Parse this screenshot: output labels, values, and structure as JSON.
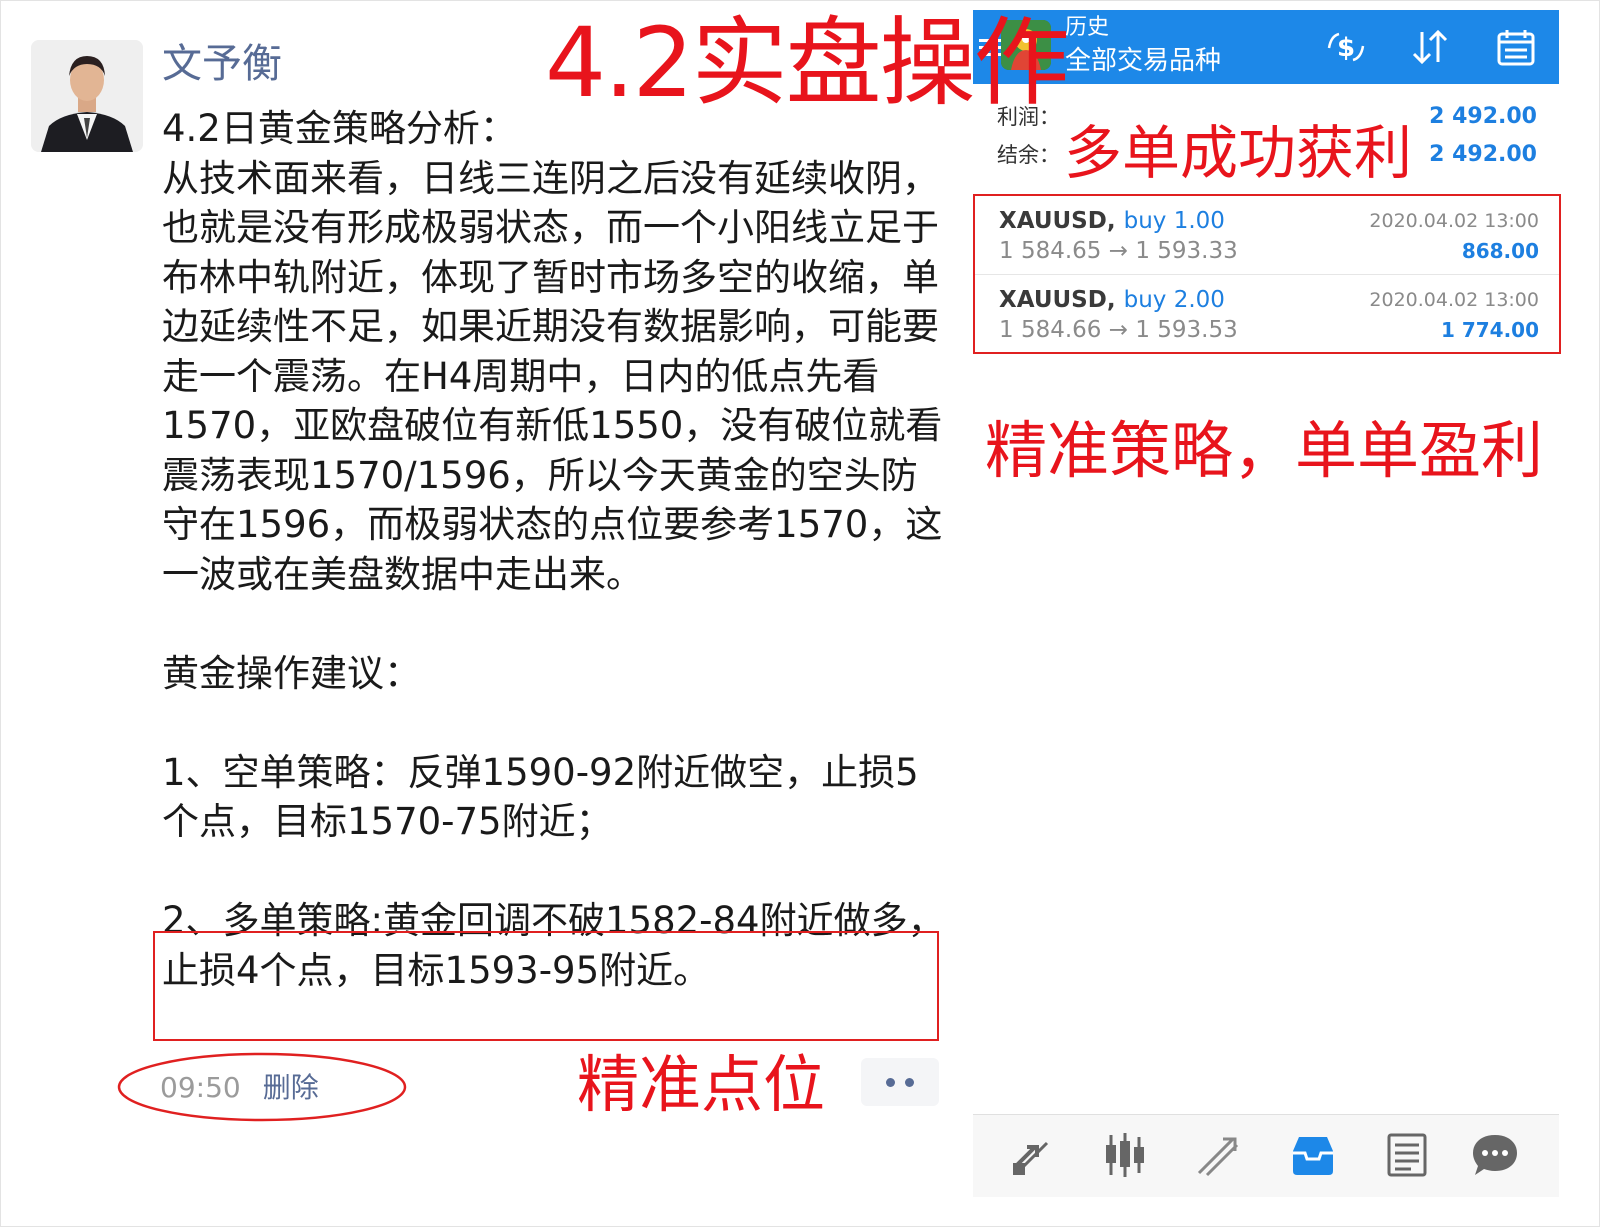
{
  "post": {
    "author": "文予衡",
    "paragraphs": [
      "4.2日黄金策略分析：\n从技术面来看，日线三连阴之后没有延续收阴，也就是没有形成极弱状态，而一个小阳线立足于布林中轨附近，体现了暂时市场多空的收缩，单边延续性不足，如果近期没有数据影响，可能要走一个震荡。在H4周期中，日内的低点先看1570，亚欧盘破位有新低1550，没有破位就看震荡表现1570/1596，所以今天黄金的空头防守在1596，而极弱状态的点位要参考1570，这一波或在美盘数据中走出来。",
      "黄金操作建议：",
      "1、空单策略：反弹1590-92附近做空，止损5个点，目标1570-75附近；",
      "2、多单策略:黄金回调不破1582-84附近做多，止损4个点，目标1593-95附近。"
    ],
    "time": "09:50",
    "delete_label": "删除",
    "more_icon": "more-dots-icon"
  },
  "annotations": {
    "title": "4.2实盘操作",
    "profit": "多单成功获利",
    "strategy": "精准策略，单单盈利",
    "point": "精准点位",
    "color": "#e8141c"
  },
  "mt4": {
    "header_title": "历史",
    "header_subtitle": "全部交易品种",
    "header_color": "#1d88e8",
    "profit_label": "利润：",
    "profit_value": "2 492.00",
    "balance_label": "结余：",
    "balance_value": "2 492.00",
    "trades": [
      {
        "symbol": "XAUUSD,",
        "action": "buy 1.00",
        "open": "1 584.65",
        "arrow": "→",
        "close": "1 593.33",
        "date": "2020.04.02 13:00",
        "pl": "868.00"
      },
      {
        "symbol": "XAUUSD,",
        "action": "buy 2.00",
        "open": "1 584.66",
        "arrow": "→",
        "close": "1 593.53",
        "date": "2020.04.02 13:00",
        "pl": "1 774.00"
      }
    ],
    "header_icons": [
      "deposit-dollar-icon",
      "sort-icon",
      "calendar-icon"
    ],
    "nav_icons": [
      "quotes-icon",
      "chart-candles-icon",
      "trade-icon",
      "history-inbox-icon",
      "news-icon",
      "chat-icon"
    ]
  }
}
